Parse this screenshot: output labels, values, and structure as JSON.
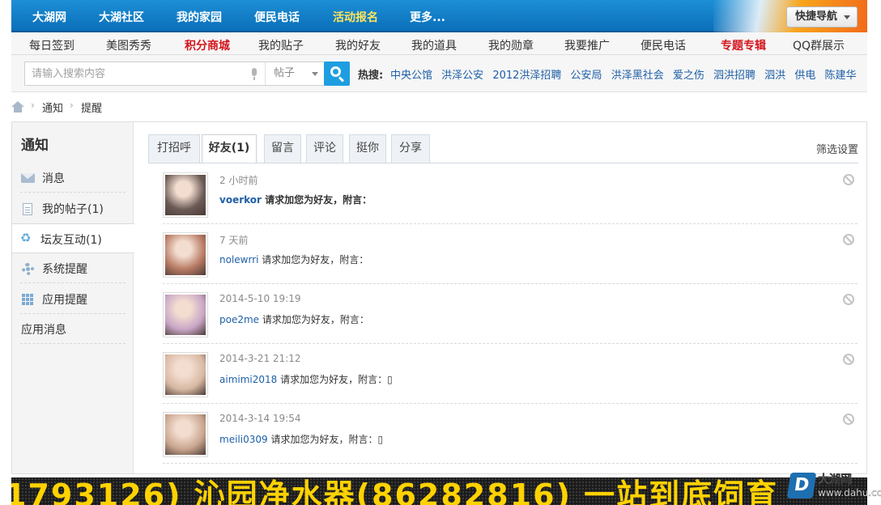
{
  "topnav": {
    "items": [
      "大湖网",
      "大湖社区",
      "我的家园",
      "便民电话",
      "活动报名",
      "更多..."
    ],
    "active_index": 4,
    "quick_nav": "快捷导航"
  },
  "subnav": {
    "items": [
      "每日签到",
      "美图秀秀",
      "积分商城",
      "我的贴子",
      "我的好友",
      "我的道具",
      "我的勋章",
      "我要推广",
      "便民电话",
      "专题专辑",
      "QQ群展示"
    ],
    "highlight": [
      "积分商城",
      "专题专辑"
    ]
  },
  "search": {
    "placeholder": "请输入搜索内容",
    "type": "帖子",
    "hot_label": "热搜:",
    "hot": [
      "中央公馆",
      "洪泽公安",
      "2012洪泽招聘",
      "公安局",
      "洪泽黑社会",
      "爱之伤",
      "泗洪招聘",
      "泗洪",
      "供电",
      "陈建华"
    ]
  },
  "breadcrumb": [
    "通知",
    "提醒"
  ],
  "sidebar": {
    "title": "通知",
    "items": [
      {
        "label": "消息",
        "icon": "envelope-icon"
      },
      {
        "label": "我的帖子(1)",
        "icon": "document-icon"
      },
      {
        "label": "坛友互动(1)",
        "icon": "recycle-icon"
      },
      {
        "label": "系统提醒",
        "icon": "gear-icon"
      },
      {
        "label": "应用提醒",
        "icon": "grid-icon"
      },
      {
        "label": "应用消息",
        "icon": ""
      }
    ],
    "active_index": 2
  },
  "tabs": {
    "items": [
      "打招呼",
      "好友(1)",
      "留言",
      "评论",
      "挺你",
      "分享"
    ],
    "active_index": 1,
    "filter": "筛选设置"
  },
  "notices": [
    {
      "time": "2 小时前",
      "user": "voerkor",
      "text": " 请求加您为好友，附言：",
      "bold": true,
      "avatar_color": "#6b5a55"
    },
    {
      "time": "7 天前",
      "user": "nolewrri",
      "text": " 请求加您为好友，附言：",
      "bold": false,
      "avatar_color": "#b77a63"
    },
    {
      "time": "2014-5-10 19:19",
      "user": "poe2me",
      "text": " 请求加您为好友，附言：",
      "bold": false,
      "avatar_color": "#c9a6c6"
    },
    {
      "time": "2014-3-21 21:12",
      "user": "aimimi2018",
      "text": " 请求加您为好友，附言：▯",
      "bold": false,
      "avatar_color": "#d8b9a3"
    },
    {
      "time": "2014-3-14 19:54",
      "user": "meili0309",
      "text": " 请求加您为好友，附言：▯",
      "bold": false,
      "avatar_color": "#c9a58e"
    }
  ],
  "banner": {
    "text": "1793126) 沁园净水器(86282816) 一站到底饲育"
  },
  "watermark": {
    "name": "大湖网",
    "url": "www.dahu.cc"
  }
}
